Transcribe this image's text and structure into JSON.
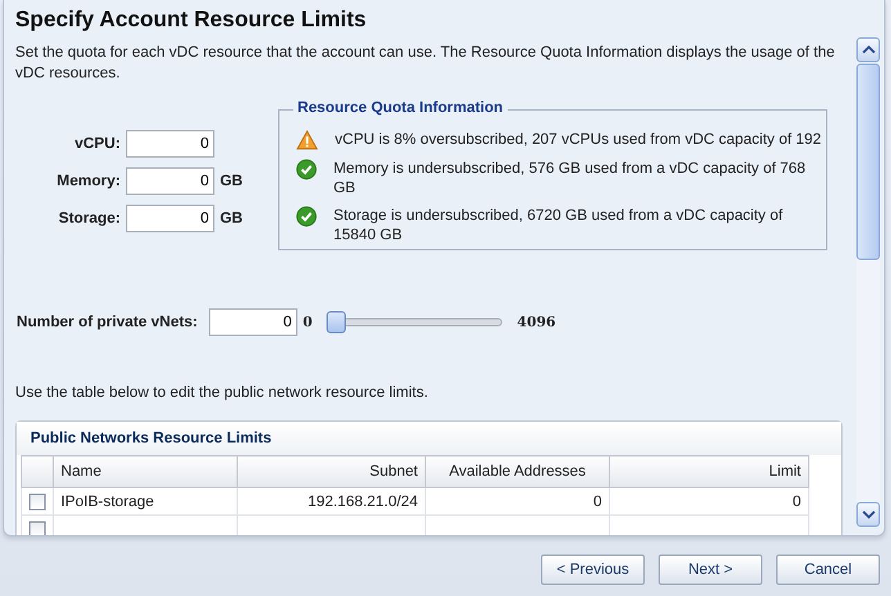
{
  "title": "Specify Account Resource Limits",
  "description": "Set the quota for each vDC resource that the account can use. The Resource Quota Information displays the usage of the vDC resources.",
  "fields": [
    {
      "label": "vCPU:",
      "value": "0"
    },
    {
      "label": "Memory:",
      "value": "0",
      "unit": "GB"
    },
    {
      "label": "Storage:",
      "value": "0",
      "unit": "GB"
    }
  ],
  "quota": {
    "title": "Resource Quota Information",
    "items": [
      {
        "kind": "warning",
        "text": "vCPU is 8% oversubscribed, 207 vCPUs used from vDC capacity of 192"
      },
      {
        "kind": "ok",
        "text": "Memory is undersubscribed, 576 GB used from a vDC capacity of 768 GB"
      },
      {
        "kind": "ok",
        "text": "Storage is undersubscribed, 6720 GB used from a vDC capacity of 15840 GB"
      }
    ]
  },
  "vnets": {
    "label": "Number of private vNets:",
    "value": "0",
    "min": "0",
    "max": "4096",
    "level": 0
  },
  "table_hint": "Use the table below to edit the public network resource limits.",
  "table": {
    "title": "Public Networks Resource Limits",
    "columns": [
      "Name",
      "Subnet",
      "Available Addresses",
      "Limit"
    ],
    "rows": [
      {
        "checked": false,
        "cells": [
          "IPoIB-storage",
          "192.168.21.0/24",
          "0",
          "0"
        ]
      },
      {
        "checked": false,
        "cells": []
      }
    ]
  },
  "buttons": [
    "< Previous",
    "Next >",
    "Cancel"
  ]
}
